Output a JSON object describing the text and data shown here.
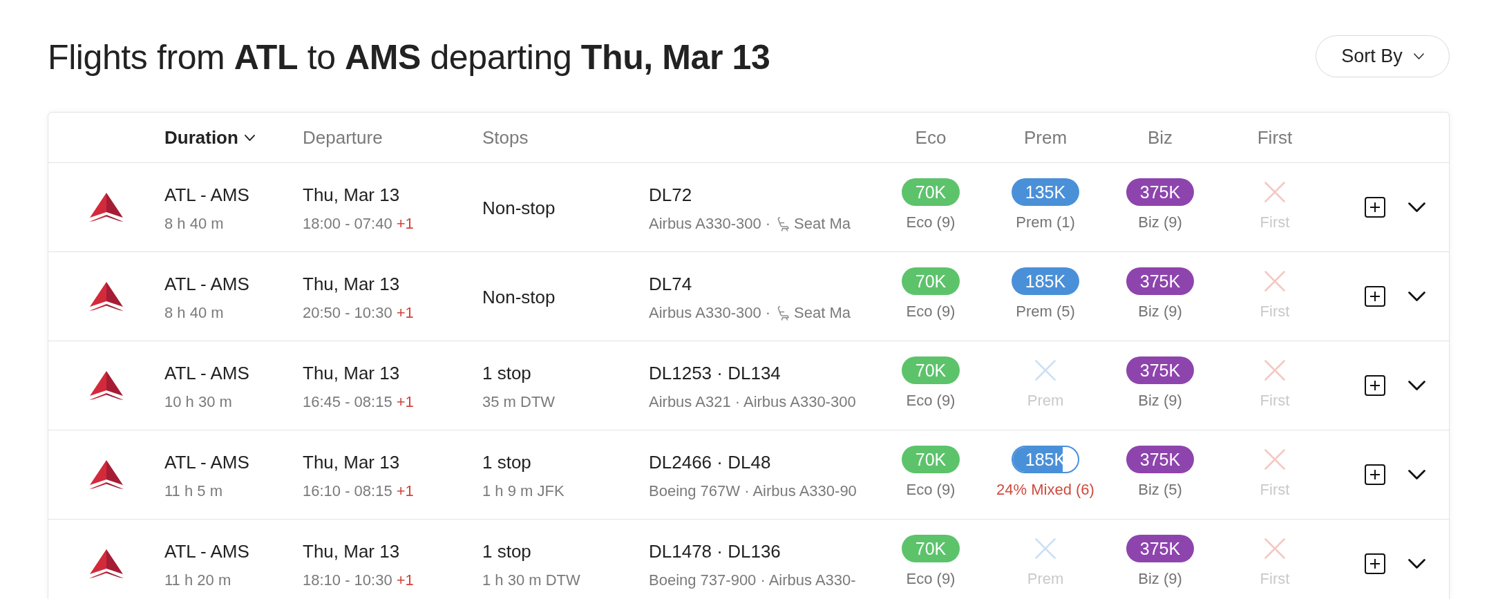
{
  "title": "Flights from **ATL** to **AMS** departing **Thu, Mar 13**",
  "sort_button": {
    "label": "Sort By"
  },
  "table": {
    "columns": [
      {
        "label": "Duration",
        "sorted": true
      },
      {
        "label": "Departure",
        "sorted": false
      },
      {
        "label": "Stops",
        "sorted": false
      }
    ],
    "cabin_columns": [
      "Eco",
      "Prem",
      "Biz",
      "First"
    ],
    "rows": [
      {
        "route": "ATL - AMS",
        "duration": "8 h 40 m",
        "date": "Thu, Mar 13",
        "times": "18:00 - 07:40",
        "day_offset": "+1",
        "stops": "Non-stop",
        "flights": "DL72",
        "aircraft": "Airbus A330-300 ·",
        "seat_map": "Seat Ma",
        "cabins": [
          {
            "kind": "available",
            "price": "70K",
            "label": "Eco (9)",
            "color": "#5cc36b"
          },
          {
            "kind": "available",
            "price": "135K",
            "label": "Prem (1)",
            "color": "#4a90d9"
          },
          {
            "kind": "available",
            "price": "375K",
            "label": "Biz (9)",
            "color": "#8e44ad"
          },
          {
            "kind": "unavailable",
            "label": "First",
            "color": "#f3c9c2"
          }
        ]
      },
      {
        "route": "ATL - AMS",
        "duration": "8 h 40 m",
        "date": "Thu, Mar 13",
        "times": "20:50 - 10:30",
        "day_offset": "+1",
        "stops": "Non-stop",
        "flights": "DL74",
        "aircraft": "Airbus A330-300 ·",
        "seat_map": "Seat Ma",
        "cabins": [
          {
            "kind": "available",
            "price": "70K",
            "label": "Eco (9)",
            "color": "#5cc36b"
          },
          {
            "kind": "available",
            "price": "185K",
            "label": "Prem (5)",
            "color": "#4a90d9"
          },
          {
            "kind": "available",
            "price": "375K",
            "label": "Biz (9)",
            "color": "#8e44ad"
          },
          {
            "kind": "unavailable",
            "label": "First",
            "color": "#f3c9c2"
          }
        ]
      },
      {
        "route": "ATL - AMS",
        "duration": "10 h 30 m",
        "date": "Thu, Mar 13",
        "times": "16:45 - 08:15",
        "day_offset": "+1",
        "stops": "1 stop",
        "layover": "35 m DTW",
        "flights": "DL1253 · DL134",
        "aircraft": "Airbus A321 · Airbus A330-300",
        "cabins": [
          {
            "kind": "available",
            "price": "70K",
            "label": "Eco (9)",
            "color": "#5cc36b"
          },
          {
            "kind": "unavailable",
            "label": "Prem",
            "color": "#cddff3"
          },
          {
            "kind": "available",
            "price": "375K",
            "label": "Biz (9)",
            "color": "#8e44ad"
          },
          {
            "kind": "unavailable",
            "label": "First",
            "color": "#f3c9c2"
          }
        ]
      },
      {
        "route": "ATL - AMS",
        "duration": "11 h 5 m",
        "date": "Thu, Mar 13",
        "times": "16:10 - 08:15",
        "day_offset": "+1",
        "stops": "1 stop",
        "layover": "1 h 9 m JFK",
        "flights": "DL2466 · DL48",
        "aircraft": "Boeing 767W · Airbus A330-90",
        "cabins": [
          {
            "kind": "available",
            "price": "70K",
            "label": "Eco (9)",
            "color": "#5cc36b"
          },
          {
            "kind": "mixed",
            "price": "185K",
            "label": "24% Mixed (6)",
            "color": "#4a90d9",
            "level": 0.76
          },
          {
            "kind": "available",
            "price": "375K",
            "label": "Biz (5)",
            "color": "#8e44ad"
          },
          {
            "kind": "unavailable",
            "label": "First",
            "color": "#f3c9c2"
          }
        ]
      },
      {
        "route": "ATL - AMS",
        "duration": "11 h 20 m",
        "date": "Thu, Mar 13",
        "times": "18:10 - 10:30",
        "day_offset": "+1",
        "stops": "1 stop",
        "layover": "1 h 30 m DTW",
        "flights": "DL1478 · DL136",
        "aircraft": "Boeing 737-900 · Airbus A330-",
        "cabins": [
          {
            "kind": "available",
            "price": "70K",
            "label": "Eco (9)",
            "color": "#5cc36b"
          },
          {
            "kind": "unavailable",
            "label": "Prem",
            "color": "#cddff3"
          },
          {
            "kind": "available",
            "price": "375K",
            "label": "Biz (9)",
            "color": "#8e44ad"
          },
          {
            "kind": "unavailable",
            "label": "First",
            "color": "#f3c9c2"
          }
        ]
      }
    ]
  }
}
